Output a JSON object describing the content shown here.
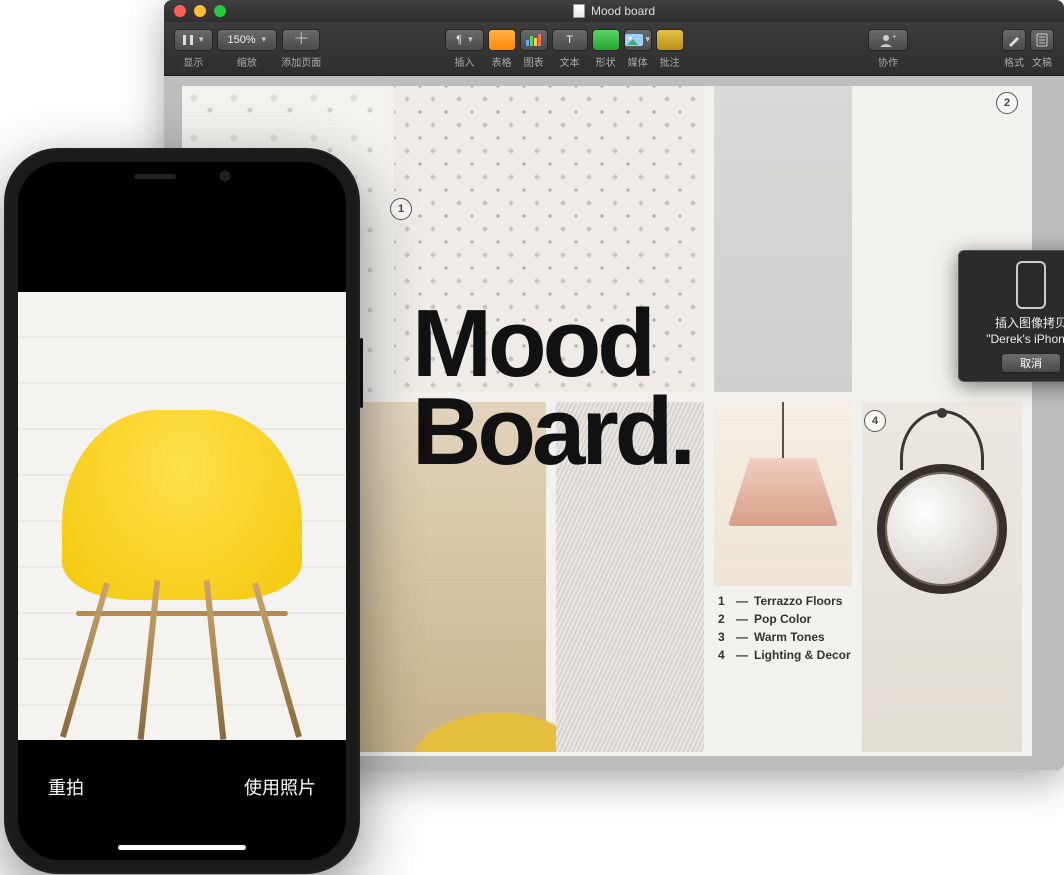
{
  "mac": {
    "title": "Mood board",
    "toolbar": {
      "view_label": "显示",
      "zoom_value": "150%",
      "zoom_label": "缩放",
      "addpage_label": "添加页面",
      "insert_label": "插入",
      "table_label": "表格",
      "chart_label": "图表",
      "text_label": "文本",
      "text_btn": "T",
      "shape_label": "形状",
      "media_label": "媒体",
      "annotate_label": "批注",
      "collab_label": "协作",
      "format_label": "格式",
      "document_label": "文稿"
    },
    "page": {
      "headline_l1": "Mood",
      "headline_l2": "Board.",
      "badges": {
        "b1": "1",
        "b2": "2",
        "b4": "4"
      },
      "legend": [
        {
          "n": "1",
          "t": "Terrazzo Floors"
        },
        {
          "n": "2",
          "t": "Pop Color"
        },
        {
          "n": "3",
          "t": "Warm Tones"
        },
        {
          "n": "4",
          "t": "Lighting & Decor"
        }
      ]
    },
    "callout": {
      "line1": "插入图像拷贝",
      "line2": "\"Derek's iPhone\"",
      "cancel": "取消"
    }
  },
  "phone": {
    "retake": "重拍",
    "use_photo": "使用照片"
  }
}
